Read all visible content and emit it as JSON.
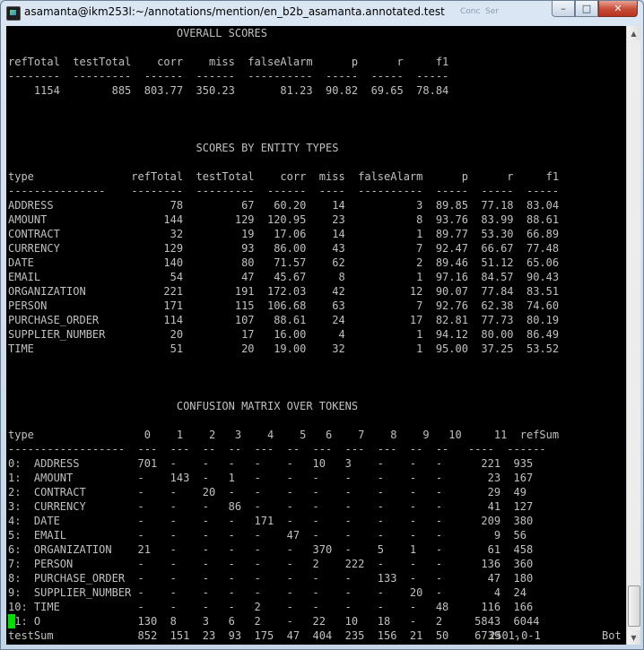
{
  "window": {
    "title": "asamanta@ikm253l:~/annotations/mention/en_b2b_asamanta.annotated.test",
    "ghost_titles": [
      "Conc",
      "Ser"
    ],
    "minimize_label": "–",
    "maximize_label": "□",
    "close_label": "✕"
  },
  "terminal": {
    "lines": [
      "                          OVERALL SCORES",
      "",
      "refTotal  testTotal    corr    miss  falseAlarm      p      r     f1",
      "--------  ---------  ------  ------  ----------  -----  -----  -----",
      "    1154        885  803.77  350.23       81.23  90.82  69.65  78.84",
      "",
      "",
      "",
      "                             SCORES BY ENTITY TYPES",
      "",
      "type               refTotal  testTotal    corr  miss  falseAlarm      p      r     f1",
      "---------------    --------  ---------  ------  ----  ----------  -----  -----  -----",
      "ADDRESS                  78         67   60.20    14           3  89.85  77.18  83.04",
      "AMOUNT                  144        129  120.95    23           8  93.76  83.99  88.61",
      "CONTRACT                 32         19   17.06    14           1  89.77  53.30  66.89",
      "CURRENCY                129         93   86.00    43           7  92.47  66.67  77.48",
      "DATE                    140         80   71.57    62           2  89.46  51.12  65.06",
      "EMAIL                    54         47   45.67     8           1  97.16  84.57  90.43",
      "ORGANIZATION            221        191  172.03    42          12  90.07  77.84  83.51",
      "PERSON                  171        115  106.68    63           7  92.76  62.38  74.60",
      "PURCHASE_ORDER          114        107   88.61    24          17  82.81  77.73  80.19",
      "SUPPLIER_NUMBER          20         17   16.00     4           1  94.12  80.00  86.49",
      "TIME                     51         20   19.00    32           1  95.00  37.25  53.52",
      "",
      "",
      "",
      "                          CONFUSION MATRIX OVER TOKENS",
      "",
      "type                 0    1    2   3    4    5   6    7    8    9   10     11  refSum",
      "------------------  ---  ---  --  --  ---  --  ---  ---  ---  --  --   ----  ------",
      "0:  ADDRESS         701  -    -   -   -    -   10   3    -    -   -      221  935",
      "1:  AMOUNT          -    143  -   1   -    -   -    -    -    -   -       23  167",
      "2:  CONTRACT        -    -    20  -   -    -   -    -    -    -   -       29  49",
      "3:  CURRENCY        -    -    -   86  -    -   -    -    -    -   -       41  127",
      "4:  DATE            -    -    -   -   171  -   -    -    -    -   -      209  380",
      "5:  EMAIL           -    -    -   -   -    47  -    -    -    -   -        9  56",
      "6:  ORGANIZATION    21   -    -   -   -    -   370  -    5    1   -       61  458",
      "7:  PERSON          -    -    -   -   -    -   2    222  -    -   -      136  360",
      "8:  PURCHASE_ORDER  -    -    -   -   -    -   -    -    133  -   -       47  180",
      "9:  SUPPLIER_NUMBER -    -    -   -   -    -   -    -    -    20  -        4  24",
      "10: TIME            -    -    -   -   2    -   -    -    -    -   48     116  166",
      "11: O               130  8    3   6   2    -   22   10   18   -   2     5843  6044",
      "testSum             852  151  23  93  175  47  404  235  156  21  50    6739  -"
    ],
    "status_position": "2501,0-1",
    "status_scroll": "Bot"
  },
  "colors": {
    "terminal_bg": "#000000",
    "terminal_fg": "#c0c0c0",
    "cursor": "#00e000"
  }
}
